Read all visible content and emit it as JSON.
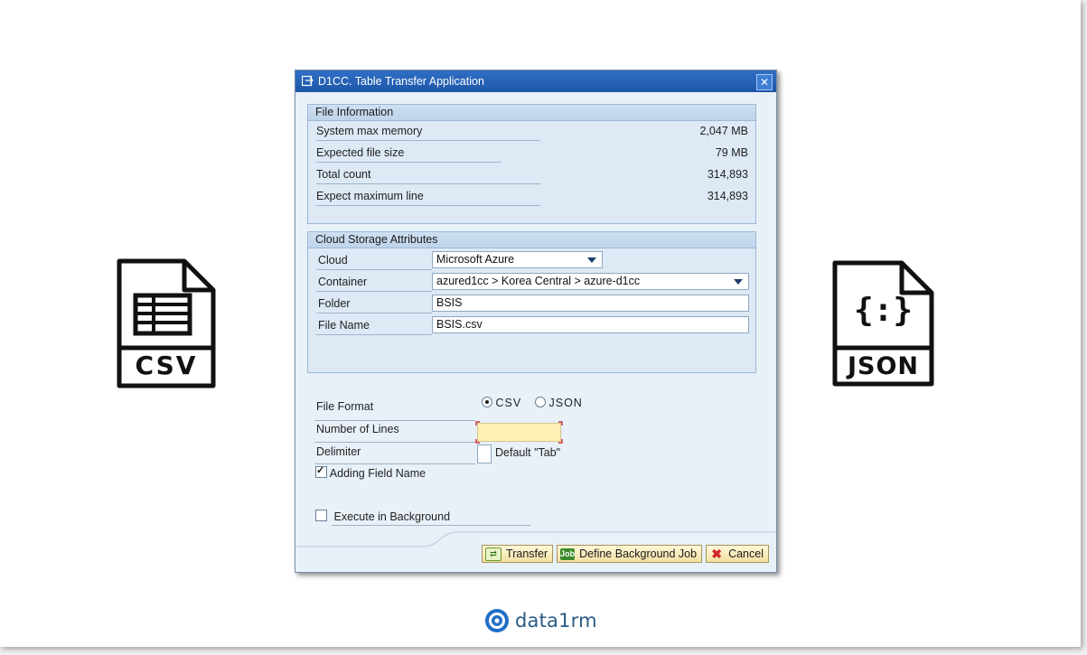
{
  "left_icon": {
    "label": "CSV",
    "icon": "csv-file-icon"
  },
  "right_icon": {
    "label": "JSON",
    "glyph": "{:}",
    "icon": "json-file-icon"
  },
  "dialog": {
    "title": "D1CC. Table Transfer Application",
    "close": "✕",
    "file_info": {
      "title": "File Information",
      "rows": [
        {
          "label": "System max memory",
          "value": "2,047 MB"
        },
        {
          "label": "Expected file size",
          "value": "79 MB"
        },
        {
          "label": "Total count",
          "value": "314,893"
        },
        {
          "label": "Expect maximum line",
          "value": "314,893"
        }
      ]
    },
    "cloud": {
      "title": "Cloud Storage Attributes",
      "cloud_label": "Cloud",
      "cloud_value": "Microsoft Azure",
      "container_label": "Container",
      "container_value": "azured1cc > Korea Central > azure-d1cc",
      "folder_label": "Folder",
      "folder_value": "BSIS",
      "filename_label": "File Name",
      "filename_value": "BSIS.csv"
    },
    "options": {
      "file_format_label": "File Format",
      "format_csv": "CSV",
      "format_json": "JSON",
      "selected_format": "CSV",
      "lines_label": "Number of Lines",
      "lines_value": "",
      "delimiter_label": "Delimiter",
      "delimiter_value": "",
      "delimiter_hint": "Default \"Tab\"",
      "adding_field_name": "Adding Field Name",
      "adding_field_checked": true,
      "execute_bg": "Execute in Background",
      "execute_bg_checked": false
    },
    "buttons": {
      "transfer": "Transfer",
      "define_bg_job": "Define Background Job",
      "cancel": "Cancel"
    }
  },
  "brand": {
    "name": "data1rm"
  },
  "colors": {
    "titlebar": "#2462b8",
    "button": "#f6e6a8",
    "input_required": "#fdf0b4",
    "brand": "#2a5a86"
  }
}
